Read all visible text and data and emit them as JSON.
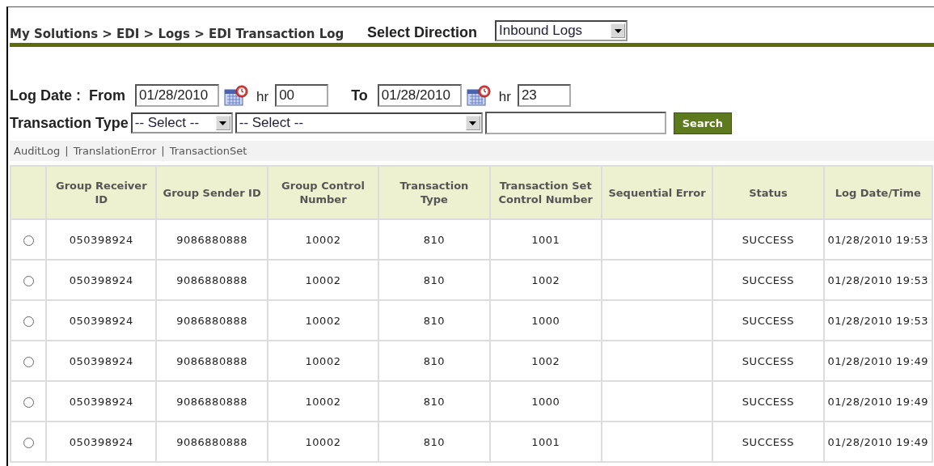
{
  "breadcrumb": "My Solutions > EDI > Logs > EDI Transaction Log",
  "direction": {
    "label": "Select Direction",
    "value": "Inbound Logs"
  },
  "log_date": {
    "label": "Log Date :",
    "from_label": "From",
    "from_value": "01/28/2010",
    "from_hr_label": "hr",
    "from_hr": "00",
    "to_label": "To",
    "to_value": "01/28/2010",
    "to_hr_label": "hr",
    "to_hr": "23"
  },
  "transaction_type": {
    "label": "Transaction Type",
    "select_1": "-- Select --",
    "select_2": "-- Select --",
    "search_button": "Search"
  },
  "links": [
    "AuditLog",
    "TranslationError",
    "TransactionSet"
  ],
  "link_separator": "|",
  "table": {
    "columns": [
      "Group Receiver ID",
      "Group Sender ID",
      "Group Control Number",
      "Transaction Type",
      "Transaction Set Control Number",
      "Sequential Error",
      "Status",
      "Log Date/Time"
    ],
    "rows": [
      {
        "selected": false,
        "cells": [
          "050398924",
          "9086880888",
          "10002",
          "810",
          "1001",
          "",
          "SUCCESS",
          "01/28/2010 19:53"
        ]
      },
      {
        "selected": false,
        "cells": [
          "050398924",
          "9086880888",
          "10002",
          "810",
          "1002",
          "",
          "SUCCESS",
          "01/28/2010 19:53"
        ]
      },
      {
        "selected": false,
        "cells": [
          "050398924",
          "9086880888",
          "10002",
          "810",
          "1000",
          "",
          "SUCCESS",
          "01/28/2010 19:53"
        ]
      },
      {
        "selected": false,
        "cells": [
          "050398924",
          "9086880888",
          "10002",
          "810",
          "1002",
          "",
          "SUCCESS",
          "01/28/2010 19:49"
        ]
      },
      {
        "selected": false,
        "cells": [
          "050398924",
          "9086880888",
          "10002",
          "810",
          "1000",
          "",
          "SUCCESS",
          "01/28/2010 19:49"
        ]
      },
      {
        "selected": false,
        "cells": [
          "050398924",
          "9086880888",
          "10002",
          "810",
          "1001",
          "",
          "SUCCESS",
          "01/28/2010 19:49"
        ]
      }
    ]
  }
}
